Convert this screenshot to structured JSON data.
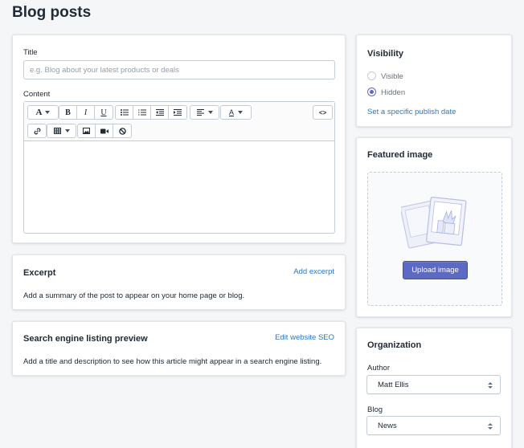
{
  "page": {
    "title": "Blog posts"
  },
  "post_form": {
    "title_label": "Title",
    "title_placeholder": "e.g. Blog about your latest products or deals",
    "title_value": "",
    "content_label": "Content",
    "toolbar": {
      "font_label": "A",
      "bold_label": "B",
      "italic_label": "I",
      "underline_label": "U",
      "color_label": "A",
      "code_label": "<>"
    }
  },
  "excerpt": {
    "heading": "Excerpt",
    "action_label": "Add excerpt",
    "description": "Add a summary of the post to appear on your home page or blog."
  },
  "seo": {
    "heading": "Search engine listing preview",
    "action_label": "Edit website SEO",
    "description": "Add a title and description to see how this article might appear in a search engine listing."
  },
  "visibility": {
    "heading": "Visibility",
    "options": [
      {
        "label": "Visible",
        "checked": false
      },
      {
        "label": "Hidden",
        "checked": true
      }
    ],
    "publish_date_link": "Set a specific publish date"
  },
  "featured_image": {
    "heading": "Featured image",
    "upload_label": "Upload image"
  },
  "organization": {
    "heading": "Organization",
    "author_label": "Author",
    "author_value": "Matt Ellis",
    "blog_label": "Blog",
    "blog_value": "News"
  },
  "colors": {
    "accent": "#5c6ac4",
    "link": "#2a78c4",
    "background": "#f4f6f8"
  }
}
